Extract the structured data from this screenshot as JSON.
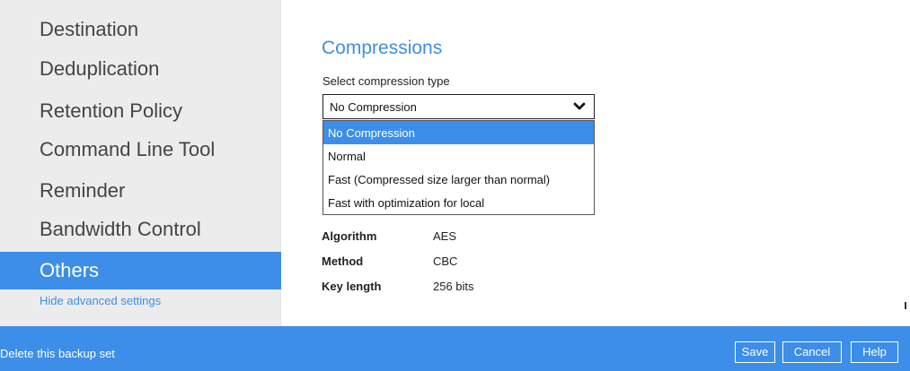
{
  "sidebar": {
    "items": [
      {
        "label": "Destination"
      },
      {
        "label": "Deduplication"
      },
      {
        "label": "Retention Policy"
      },
      {
        "label": "Command Line Tool"
      },
      {
        "label": "Reminder"
      },
      {
        "label": "Bandwidth Control"
      },
      {
        "label": "Others",
        "active": true
      }
    ],
    "hide_advanced": "Hide advanced settings"
  },
  "main": {
    "section_title": "Compressions",
    "select_label": "Select compression type",
    "select_value": "No Compression",
    "options": [
      {
        "label": "No Compression",
        "selected": true
      },
      {
        "label": "Normal"
      },
      {
        "label": "Fast (Compressed size larger than normal)"
      },
      {
        "label": "Fast with optimization for local"
      }
    ],
    "encryption": [
      {
        "key": "Algorithm",
        "value": "AES"
      },
      {
        "key": "Method",
        "value": "CBC"
      },
      {
        "key": "Key length",
        "value": "256 bits"
      }
    ]
  },
  "footer": {
    "delete": "Delete this backup set",
    "save": "Save",
    "cancel": "Cancel",
    "help": "Help"
  },
  "colors": {
    "accent": "#3d8ee9",
    "sidebar_bg": "#ececec",
    "sidebar_text": "#444444"
  },
  "icons": {
    "select_arrow": "chevron-down-icon"
  }
}
